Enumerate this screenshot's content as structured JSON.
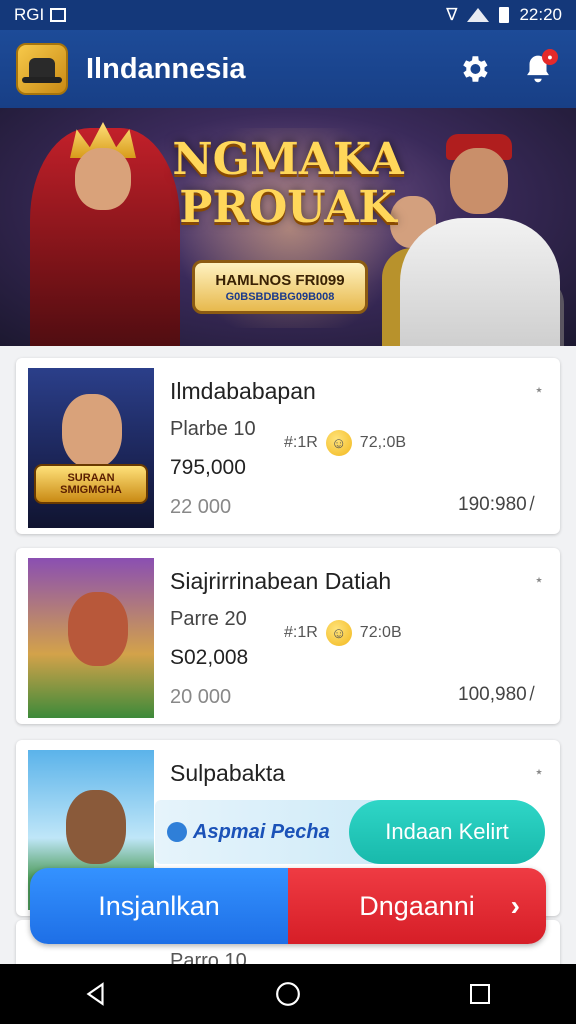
{
  "status": {
    "left": "RGI",
    "time": "22:20"
  },
  "appbar": {
    "title": "Ilndannesia"
  },
  "banner": {
    "title": "NGMAKA PROUAK",
    "plate_line1": "HAMLNOS FRI099",
    "plate_line2": "G0BSBDBBG09B008"
  },
  "cards": [
    {
      "title": "Ilmdababapan",
      "line1": "Plarbe 10",
      "line2": "795,000",
      "line3": "22 000",
      "rate_code": "#:1R",
      "rate_value": "72,:0B",
      "right_value": "190:980 ̸",
      "badge": "SURAAN SMIGMGHA"
    },
    {
      "title": "Siajrirrinabean Datiah",
      "line1": "Parre 20",
      "line2": "S02,008",
      "line3": "20 000",
      "rate_code": "#:1R",
      "rate_value": "72:0B",
      "right_value": "100,980 ̸"
    },
    {
      "title": "Sulpabakta",
      "line1": "",
      "line2": "",
      "line3": ""
    }
  ],
  "card4_peek": "Parro 10",
  "promo": {
    "brand": "Aspmai Pecha",
    "button": "Indaan Kelirt"
  },
  "actions": {
    "left": "Insjanlkan",
    "right": "Dngaanni"
  },
  "colors": {
    "appbar": "#1d4b98",
    "primary_button": "#1e6fe6",
    "danger_button": "#d61e27",
    "teal_button": "#18b9ab"
  }
}
